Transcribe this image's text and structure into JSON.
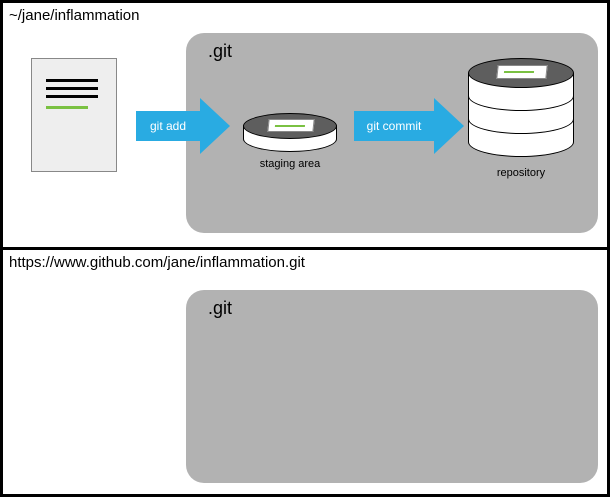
{
  "top": {
    "path": "~/jane/inflammation",
    "git_label": ".git",
    "arrow_add": "git add",
    "arrow_commit": "git commit",
    "staging_caption": "staging area",
    "repo_caption": "repository"
  },
  "bottom": {
    "url": "https://www.github.com/jane/inflammation.git",
    "git_label": ".git"
  }
}
